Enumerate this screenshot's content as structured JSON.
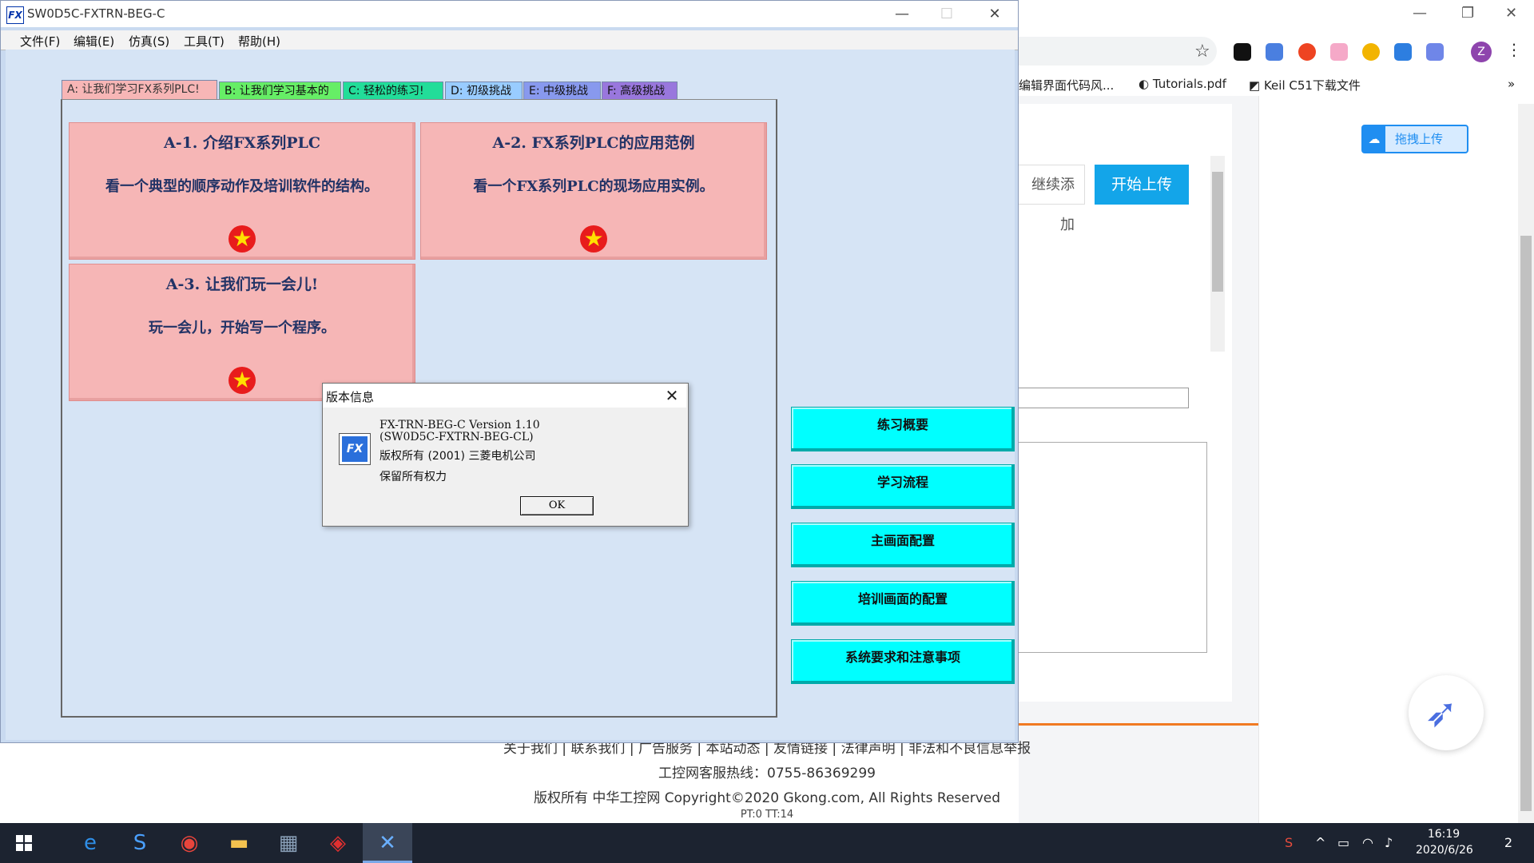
{
  "app": {
    "title": "SW0D5C-FXTRN-BEG-C",
    "logo": "FX",
    "menus": [
      "文件(F)",
      "编辑(E)",
      "仿真(S)",
      "工具(T)",
      "帮助(H)"
    ],
    "tabs": [
      "A: 让我们学习FX系列PLC!",
      "B: 让我们学习基本的",
      "C: 轻松的练习!",
      "D: 初级挑战",
      "E: 中级挑战",
      "F: 高级挑战"
    ],
    "lessons": [
      {
        "title": "A-1. 介绍FX系列PLC",
        "desc": "看一个典型的顺序动作及培训软件的结构。"
      },
      {
        "title": "A-2. FX系列PLC的应用范例",
        "desc": "看一个FX系列PLC的现场应用实例。"
      },
      {
        "title": "A-3. 让我们玩一会儿!",
        "desc": "玩一会儿，开始写一个程序。"
      }
    ],
    "side_buttons": [
      "练习概要",
      "学习流程",
      "主画面配置",
      "培训画面的配置",
      "系统要求和注意事项"
    ],
    "lesson_color": "#f6b6b6",
    "side_button_color": "#00ffff"
  },
  "dialog": {
    "title": "版本信息",
    "line1": "FX-TRN-BEG-C Version 1.10",
    "line2": "(SW0D5C-FXTRN-BEG-CL)",
    "copyright": "版权所有 (2001)  三菱电机公司",
    "rights": "保留所有权力",
    "ok": "OK"
  },
  "browser": {
    "bookmarks": [
      "编辑界面代码风...",
      "Tutorials.pdf",
      "Keil C51下载文件"
    ],
    "avatar_letter": "Z",
    "continue_label": "继续添加",
    "start_upload": "开始上传",
    "drag_upload": "拖拽上传",
    "footer_links": "关于我们 | 联系我们 | 广告服务 | 本站动态 | 友情链接 | 法律声明 | 非法和不良信息举报",
    "footer_hotline": "工控网客服热线：0755-86369299",
    "footer_copyright": "版权所有 中华工控网 Copyright©2020 Gkong.com, All Rights Reserved",
    "footer_pt": "PT:0 TT:14"
  },
  "taskbar": {
    "time": "16:19",
    "date": "2020/6/26",
    "notifications": "2"
  }
}
